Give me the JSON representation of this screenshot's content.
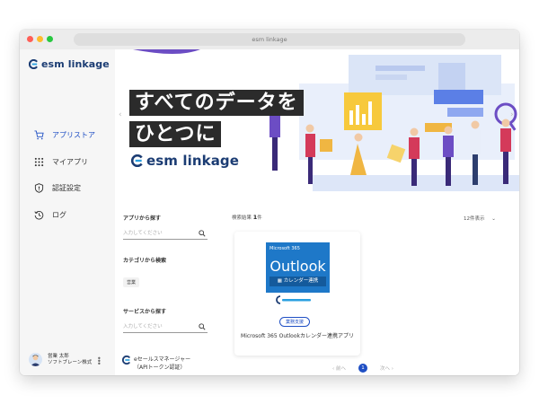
{
  "browser": {
    "url": "esm linkage"
  },
  "app": {
    "name": "esm linkage",
    "brand_color": "#1b3c73",
    "accent_color": "#1f4fc4"
  },
  "sidebar": {
    "items": [
      {
        "label": "アプリストア",
        "icon": "cart-icon",
        "active": true
      },
      {
        "label": "マイアプリ",
        "icon": "grid-icon",
        "active": false
      },
      {
        "label": "認証設定",
        "icon": "shield-icon",
        "active": false
      },
      {
        "label": "ログ",
        "icon": "history-icon",
        "active": false
      }
    ],
    "user": {
      "name": "営業 太郎",
      "company": "ソフトブレーン株式"
    }
  },
  "banner": {
    "headline_line1": "すべてのデータを",
    "headline_line2": "ひとつに",
    "logo": "esm linkage"
  },
  "filters": {
    "app_search": {
      "label": "アプリから探す",
      "placeholder": "入力してください"
    },
    "category": {
      "label": "カテゴリから検索",
      "chip": "営業"
    },
    "service_search": {
      "label": "サービスから探す",
      "placeholder": "入力してください"
    },
    "service_item": {
      "line1": "eセールスマネージャー",
      "line2": "（APIトークン認証）"
    }
  },
  "results": {
    "count_label": "検索結果",
    "count": "1",
    "count_unit": "件",
    "per_page": "12件表示"
  },
  "card": {
    "image_label": "Microsoft 365",
    "image_title": "Outlook",
    "image_band": "カレンダー連携",
    "tag": "業務支援",
    "title": "Microsoft 365 Outlookカレンダー連携アプリ"
  },
  "pagination": {
    "prev": "前へ",
    "page": "1",
    "next": "次へ"
  }
}
